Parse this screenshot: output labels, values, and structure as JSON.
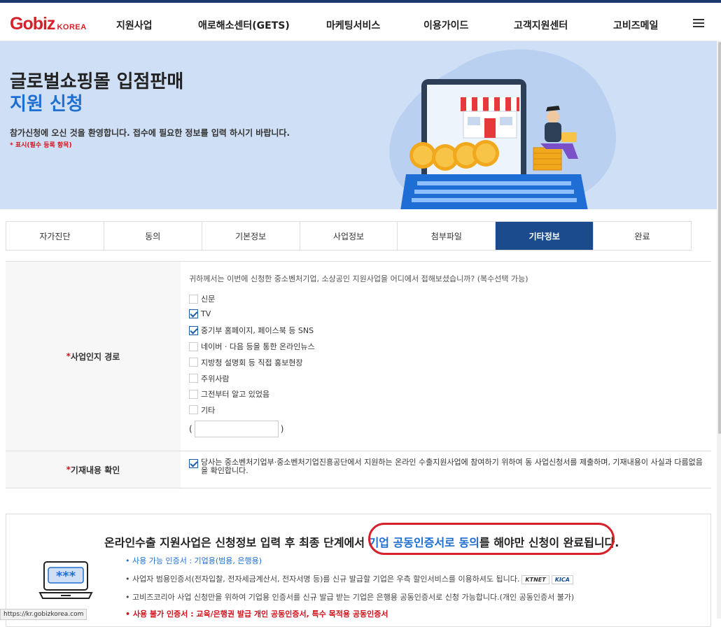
{
  "header": {
    "logo_main": "Gobiz",
    "logo_sub": "KOREA",
    "nav": [
      "지원사업",
      "애로해소센터(GETS)",
      "마케팅서비스",
      "이용가이드",
      "고객지원센터",
      "고비즈메일"
    ]
  },
  "hero": {
    "title_line1": "글로벌쇼핑몰 입점판매",
    "title_line2": "지원 신청",
    "welcome": "참가신청에 오신 것을 환영합니다. 접수에 필요한 정보를 입력 하시기 바랍니다.",
    "required_note": "* 표시(필수 등록 항목)"
  },
  "steps": {
    "items": [
      "자가진단",
      "동의",
      "기본정보",
      "사업정보",
      "첨부파일",
      "기타정보",
      "완료"
    ],
    "active": "기타정보"
  },
  "form": {
    "source": {
      "label": "사업인지 경로",
      "star": "*",
      "question": "귀하께서는 이번에 신청한 중소벤처기업, 소상공인 지원사업을 어디에서 접해보셨습니까? (복수선택 가능)",
      "options": [
        {
          "label": "신문",
          "checked": false
        },
        {
          "label": "TV",
          "checked": true
        },
        {
          "label": "중기부 홈페이지, 페이스북 등 SNS",
          "checked": true
        },
        {
          "label": "네이버 · 다음 등을 통한 온라인뉴스",
          "checked": false
        },
        {
          "label": "지방청 설명회 등 직접 홍보현장",
          "checked": false
        },
        {
          "label": "주위사람",
          "checked": false
        },
        {
          "label": "그전부터 알고 있었음",
          "checked": false
        },
        {
          "label": "기타",
          "checked": false
        }
      ],
      "etc_open": "(",
      "etc_close": ")",
      "etc_value": ""
    },
    "confirm": {
      "label": "기재내용 확인",
      "star": "*",
      "checked": true,
      "text": "당사는 중소벤처기업부·중소벤처기업진흥공단에서 지원하는 온라인 수출지원사업에 참여하기 위하여 동 사업신청서를 제출하며, 기재내용이 사실과 다름없음을 확인합니다."
    }
  },
  "notice": {
    "title_pre": "온라인수출 지원사업은 신청정보 입력 후 최종 단계에서 ",
    "title_hl": "기업 공동인증서로 동의",
    "title_post": "를 해야만 신청이 완료됩니다.",
    "line1": "• 사용 가능 인증서 : 기업용(범용, 은행용)",
    "line2": "• 사업자 범용인증서(전자입찰, 전자세금계산서, 전자서명 등)를 신규 발급할 기업은 우측 할인서비스를 이용하셔도 됩니다.",
    "badge_kt": "KTNET",
    "badge_kica": "KICA",
    "line3": "• 고비즈코리아 사업 신청만을 위하여 기업용 인증서를 신규 발급 받는 기업은 은행용 공동인증서로 신청 가능합니다.(개인 공동인증서 불가)",
    "line4": "• 사용 불가 인증서 : 교육/은행권 발급 개인 공동인증서, 특수 목적용 공동인증서",
    "laptop_text": "***"
  },
  "status_url": "https://kr.gobizkorea.com",
  "colors": {
    "brand_red": "#d6202a",
    "navy": "#1b4b8c",
    "link_blue": "#1e6fd0",
    "hero_bg": "#cfe0f6"
  }
}
